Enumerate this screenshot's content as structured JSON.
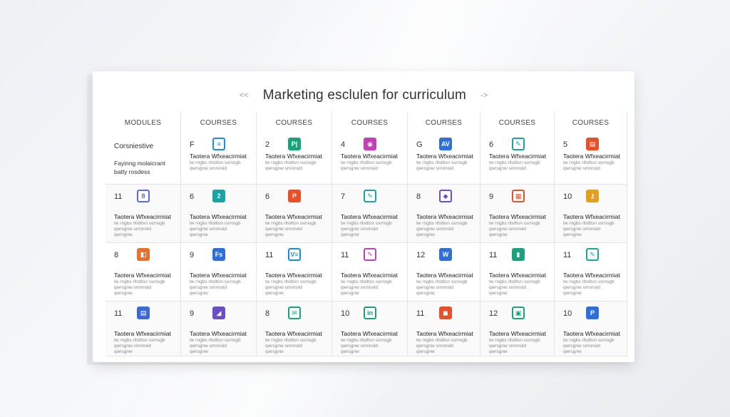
{
  "title": "Marketing esclulen for curriculum",
  "nav": {
    "prev": "<<",
    "next": "->"
  },
  "headers": [
    "MODULES",
    "COURSES",
    "COURSES",
    "COURSES",
    "COURSES",
    "COURSES",
    "COURSES"
  ],
  "module": {
    "title": "Corsniestive",
    "sub1": "Fayinng molaicrant",
    "sub2": "batty rosdess"
  },
  "lesson_title": "Taotera Wfxeacirmiat",
  "lesson_sub1": "tw rngbs rltstltsn ssrnsgb",
  "lesson_sub2": "qwrsgnw srnnnsld",
  "lesson_sub3": "qwrsgnw",
  "rows": [
    [
      null,
      {
        "num": "F",
        "icon": "document-icon",
        "glyph": "≡",
        "color": "#1f8fd6",
        "style": "outline"
      },
      {
        "num": "2",
        "icon": "publisher-icon",
        "glyph": "P|",
        "color": "#1aa37a",
        "style": "solid"
      },
      {
        "num": "4",
        "icon": "location-pin-icon",
        "glyph": "◉",
        "color": "#c23fb8",
        "style": "solid"
      },
      {
        "num": "G",
        "icon": "av-icon",
        "glyph": "AV",
        "color": "#2f6fd8",
        "style": "solid"
      },
      {
        "num": "6",
        "icon": "pen-icon",
        "glyph": "✎",
        "color": "#1aa3a3",
        "style": "outline"
      },
      {
        "num": "5",
        "icon": "clipboard-icon",
        "glyph": "▤",
        "color": "#e8502a",
        "style": "solid"
      }
    ],
    [
      {
        "num": "11",
        "icon": "share-icon",
        "glyph": "8",
        "color": "#5a6ad8",
        "style": "outline"
      },
      {
        "num": "6",
        "icon": "note-icon",
        "glyph": "2",
        "color": "#1aa3a3",
        "style": "solid"
      },
      {
        "num": "6",
        "icon": "powerpoint-icon",
        "glyph": "P",
        "color": "#e8502a",
        "style": "solid"
      },
      {
        "num": "7",
        "icon": "pen-icon",
        "glyph": "✎",
        "color": "#1aa3a3",
        "style": "outline"
      },
      {
        "num": "8",
        "icon": "bird-icon",
        "glyph": "◆",
        "color": "#6a4fc8",
        "style": "outline"
      },
      {
        "num": "9",
        "icon": "calendar-icon",
        "glyph": "▦",
        "color": "#e8502a",
        "style": "outline"
      },
      {
        "num": "10",
        "icon": "key-icon",
        "glyph": "⚷",
        "color": "#e0a020",
        "style": "solid"
      }
    ],
    [
      {
        "num": "8",
        "icon": "folder-icon",
        "glyph": "◧",
        "color": "#e8702a",
        "style": "solid"
      },
      {
        "num": "9",
        "icon": "fs-icon",
        "glyph": "Fs",
        "color": "#2f6fd8",
        "style": "solid"
      },
      {
        "num": "11",
        "icon": "vertical-app-icon",
        "glyph": "V≡",
        "color": "#1a8fd0",
        "style": "outline"
      },
      {
        "num": "11",
        "icon": "pen-icon",
        "glyph": "✎",
        "color": "#c23fb8",
        "style": "outline"
      },
      {
        "num": "12",
        "icon": "word-icon",
        "glyph": "W",
        "color": "#2f6fd8",
        "style": "solid"
      },
      {
        "num": "11",
        "icon": "chart-icon",
        "glyph": "▮",
        "color": "#1aa37a",
        "style": "solid"
      },
      {
        "num": "11",
        "icon": "pen-icon",
        "glyph": "✎",
        "color": "#1aa3a3",
        "style": "outline"
      }
    ],
    [
      {
        "num": "11",
        "icon": "slides-icon",
        "glyph": "▤",
        "color": "#3a6ad8",
        "style": "solid"
      },
      {
        "num": "9",
        "icon": "gradient-app-icon",
        "glyph": "◢",
        "color": "#6a4fc8",
        "style": "solid"
      },
      {
        "num": "8",
        "icon": "chat-icon",
        "glyph": "✉",
        "color": "#1aa37a",
        "style": "outline"
      },
      {
        "num": "10",
        "icon": "linkedin-icon",
        "glyph": "in",
        "color": "#1aa37a",
        "style": "outline"
      },
      {
        "num": "11",
        "icon": "office-icon",
        "glyph": "◼",
        "color": "#e8502a",
        "style": "solid"
      },
      {
        "num": "12",
        "icon": "spreadsheet-icon",
        "glyph": "▣",
        "color": "#1aa37a",
        "style": "outline"
      },
      {
        "num": "10",
        "icon": "publisher-icon",
        "glyph": "P",
        "color": "#2f6fd8",
        "style": "solid"
      }
    ]
  ]
}
